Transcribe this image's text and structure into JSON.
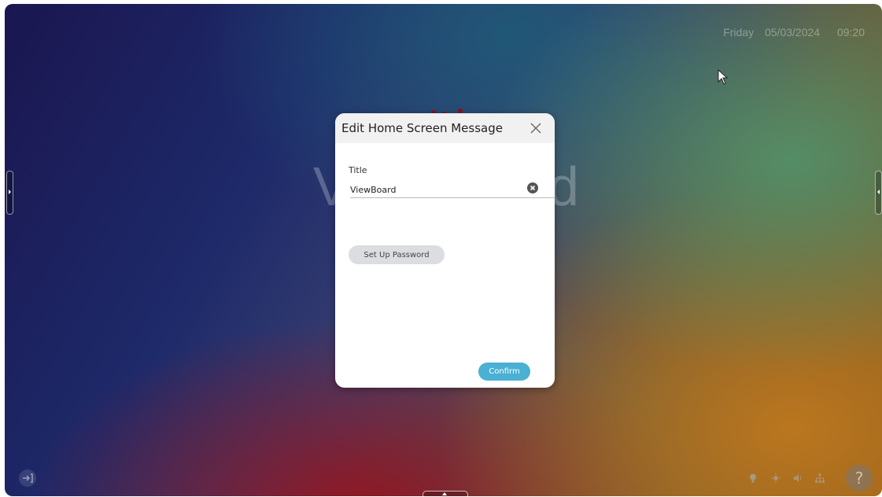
{
  "status_bar": {
    "day": "Friday",
    "date": "05/03/2024",
    "time": "09:20"
  },
  "dialog": {
    "title": "Edit Home Screen Message",
    "field_label": "Title",
    "title_value": "ViewBoard",
    "password_button": "Set Up Password",
    "confirm_button": "Confirm"
  },
  "help": {
    "label": "?"
  },
  "icons": [
    "close-icon",
    "clear-icon",
    "exit-icon",
    "bulb-icon",
    "brightness-icon",
    "volume-icon",
    "network-icon",
    "cursor-icon"
  ],
  "colors": {
    "confirm": "#4ab0d4",
    "password_button": "#dcdde1"
  }
}
